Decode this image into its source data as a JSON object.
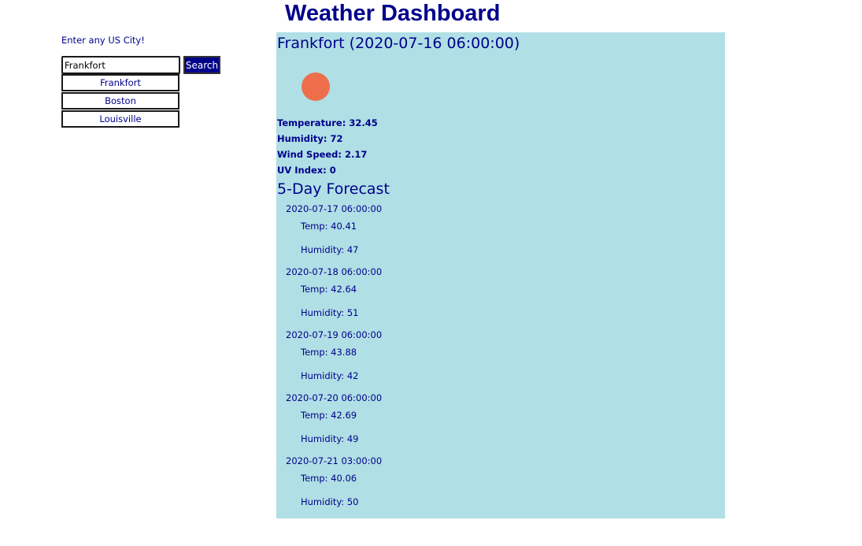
{
  "header": {
    "title": "Weather Dashboard"
  },
  "sidebar": {
    "prompt": "Enter any US City!",
    "search": {
      "value": "Frankfort",
      "placeholder": ""
    },
    "search_button_label": "Search",
    "history": [
      "Frankfort",
      "Boston",
      "Louisville"
    ]
  },
  "current": {
    "heading": "Frankfort (2020-07-16 06:00:00)",
    "icon": "sun-icon",
    "icon_color": "#ee6e4c",
    "temperature": "Temperature: 32.45",
    "humidity": "Humidity: 72",
    "wind": "Wind Speed: 2.17",
    "uv": "UV Index: 0"
  },
  "forecast": {
    "heading": "5-Day Forecast",
    "days": [
      {
        "date": "2020-07-17 06:00:00",
        "temp": "Temp: 40.41",
        "humidity": "Humidity: 47"
      },
      {
        "date": "2020-07-18 06:00:00",
        "temp": "Temp: 42.64",
        "humidity": "Humidity: 51"
      },
      {
        "date": "2020-07-19 06:00:00",
        "temp": "Temp: 43.88",
        "humidity": "Humidity: 42"
      },
      {
        "date": "2020-07-20 06:00:00",
        "temp": "Temp: 42.69",
        "humidity": "Humidity: 49"
      },
      {
        "date": "2020-07-21 03:00:00",
        "temp": "Temp: 40.06",
        "humidity": "Humidity: 50"
      }
    ]
  },
  "colors": {
    "text": "#00008b",
    "panel_background": "#b0dfe5",
    "button_background": "#00008b"
  }
}
